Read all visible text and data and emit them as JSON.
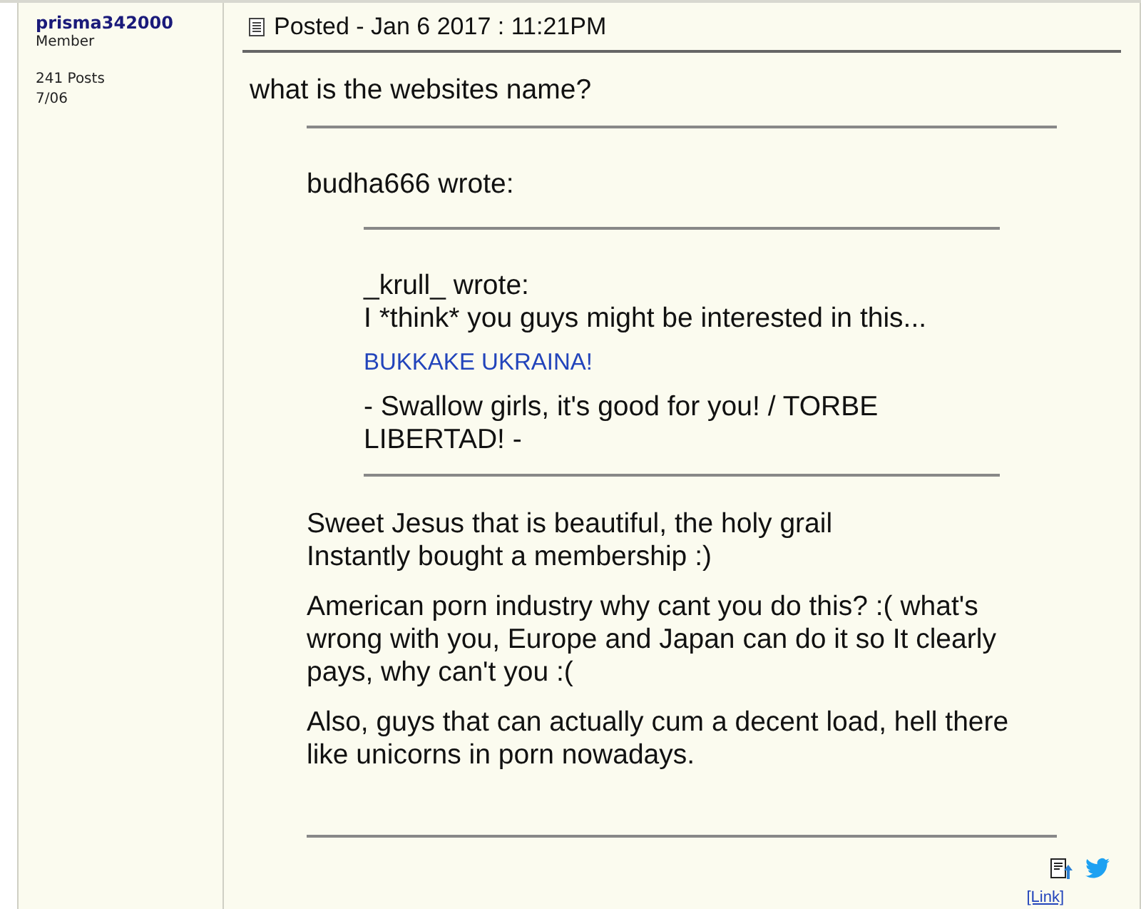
{
  "author": {
    "name": "prisma342000",
    "rank": "Member",
    "posts": "241 Posts",
    "joined": "7/06"
  },
  "post": {
    "posted": "Posted - Jan 6 2017 : 11:21PM",
    "message": "what is the websites name?",
    "quote": {
      "header": "budha666 wrote:",
      "quote": {
        "header": "_krull_ wrote:",
        "lines": [
          "I *think* you guys might be interested in this..."
        ],
        "link": "BUKKAKE UKRAINA!",
        "after": "- Swallow girls, it's good for you! / TORBE LIBERTAD! -"
      },
      "paragraphs": [
        "Sweet Jesus that is beautiful, the holy grail\nInstantly bought a membership :)",
        "American porn industry why cant you do this? :( what's wrong with you, Europe and Japan can do it so It clearly pays, why can't you :(",
        "Also, guys that can actually cum a decent load, hell there like unicorns in porn nowadays."
      ]
    },
    "footer_link": "[Link]"
  }
}
